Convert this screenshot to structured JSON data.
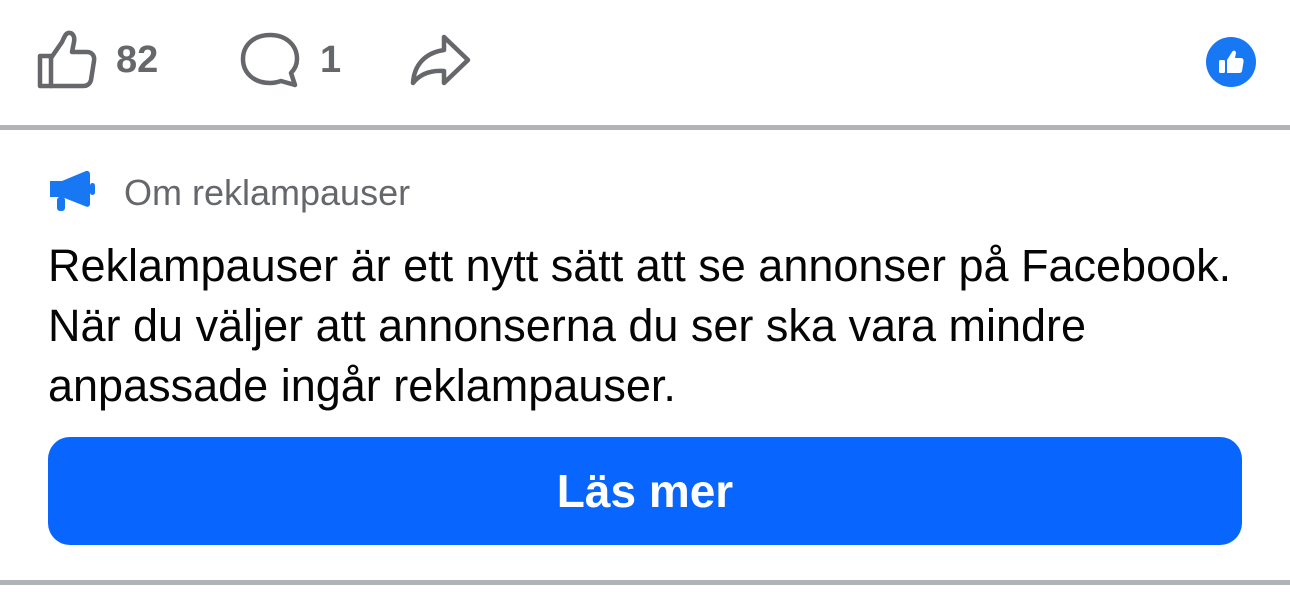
{
  "post_actions": {
    "like": {
      "icon": "thumbs-up-outline-icon",
      "count": "82"
    },
    "comment": {
      "icon": "comment-bubble-icon",
      "count": "1"
    },
    "share": {
      "icon": "share-arrow-icon"
    },
    "reaction_summary": {
      "icon": "like-reaction-icon",
      "color": "#1877f2"
    }
  },
  "ad_break_info": {
    "icon": "megaphone-icon",
    "icon_color": "#1877f2",
    "label": "Om reklampauser",
    "description": "Reklampauser är ett nytt sätt att se annonser på Facebook. När du väljer att annonserna du ser ska vara mindre anpassade ingår reklampauser.",
    "button_label": "Läs mer",
    "button_color": "#0866ff"
  }
}
